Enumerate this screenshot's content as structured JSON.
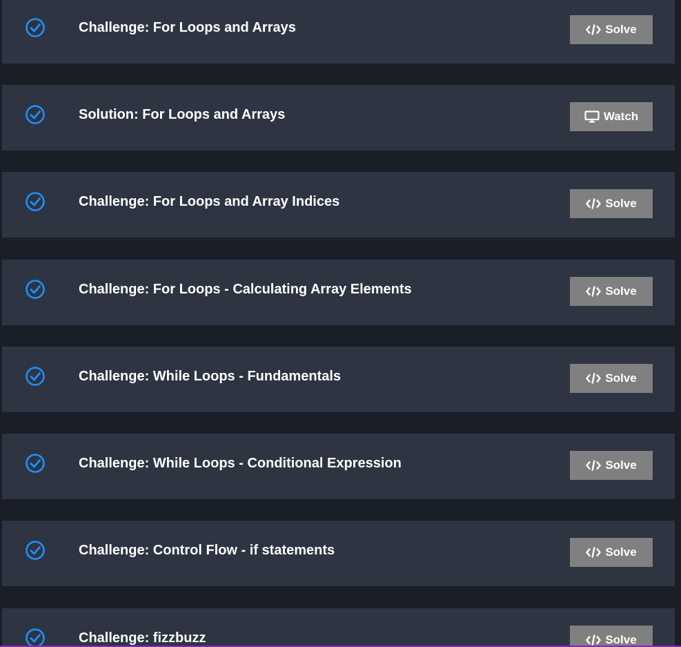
{
  "colors": {
    "page_background": "#1a1e26",
    "row_background": "#2e3442",
    "check_blue": "#1e90ff",
    "button_gray": "#808080",
    "text": "#ffffff",
    "bottom_accent": "#7b2fa8"
  },
  "lessons": [
    {
      "status_icon": "check-circle-icon",
      "title": "Challenge: For Loops and Arrays",
      "action_icon": "code-icon",
      "action_label": "Solve"
    },
    {
      "status_icon": "check-circle-icon",
      "title": "Solution: For Loops and Arrays",
      "action_icon": "monitor-icon",
      "action_label": "Watch"
    },
    {
      "status_icon": "check-circle-icon",
      "title": "Challenge: For Loops and Array Indices",
      "action_icon": "code-icon",
      "action_label": "Solve"
    },
    {
      "status_icon": "check-circle-icon",
      "title": "Challenge: For Loops - Calculating Array Elements",
      "action_icon": "code-icon",
      "action_label": "Solve"
    },
    {
      "status_icon": "check-circle-icon",
      "title": "Challenge: While Loops - Fundamentals",
      "action_icon": "code-icon",
      "action_label": "Solve"
    },
    {
      "status_icon": "check-circle-icon",
      "title": "Challenge: While Loops - Conditional Expression",
      "action_icon": "code-icon",
      "action_label": "Solve"
    },
    {
      "status_icon": "check-circle-icon",
      "title": "Challenge: Control Flow - if statements",
      "action_icon": "code-icon",
      "action_label": "Solve"
    },
    {
      "status_icon": "check-circle-icon",
      "title": "Challenge: fizzbuzz",
      "action_icon": "code-icon",
      "action_label": "Solve"
    }
  ]
}
